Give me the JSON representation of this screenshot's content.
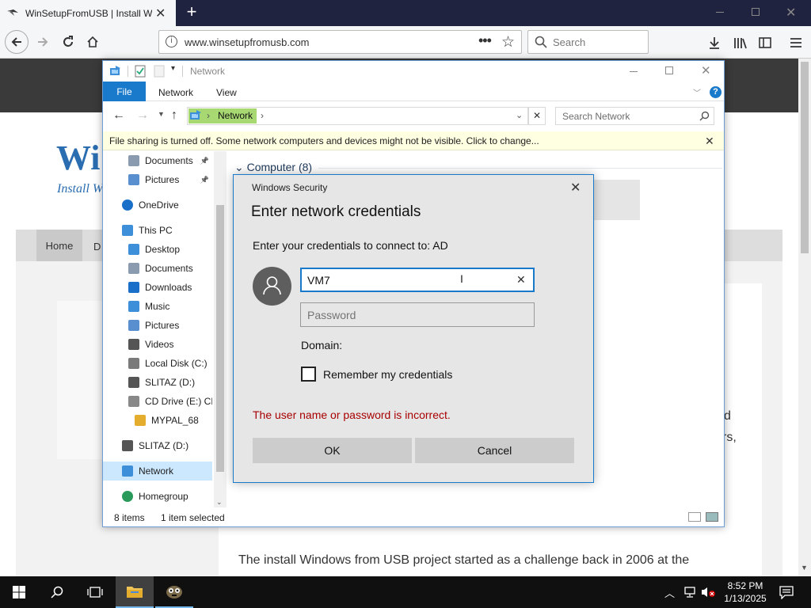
{
  "browser": {
    "tab_title": "WinSetupFromUSB | Install Win",
    "url": "www.winsetupfromusb.com",
    "search_placeholder": "Search"
  },
  "webpage": {
    "site_title": "Wi",
    "site_tagline": "Install W",
    "nav_home": "Home",
    "nav_next": "D",
    "side_text_1": "d",
    "side_text_2": "rs,",
    "paragraph": "The install Windows from USB project started as a challenge back in 2006 at the"
  },
  "explorer": {
    "title": "Network",
    "ribbon_tabs": [
      "File",
      "Network",
      "View"
    ],
    "address_crumb": "Network",
    "search_placeholder": "Search Network",
    "infobar": "File sharing is turned off. Some network computers and devices might not be visible. Click to change...",
    "group_header": "Computer (8)",
    "nav_items": [
      {
        "label": "Documents",
        "icon": "documents-icon",
        "pinned": true
      },
      {
        "label": "Pictures",
        "icon": "pictures-icon",
        "pinned": true
      },
      {
        "label": "OneDrive",
        "icon": "onedrive-icon"
      },
      {
        "label": "This PC",
        "icon": "this-pc-icon"
      },
      {
        "label": "Desktop",
        "icon": "desktop-icon"
      },
      {
        "label": "Documents",
        "icon": "documents-icon"
      },
      {
        "label": "Downloads",
        "icon": "downloads-icon"
      },
      {
        "label": "Music",
        "icon": "music-icon"
      },
      {
        "label": "Pictures",
        "icon": "pictures-icon"
      },
      {
        "label": "Videos",
        "icon": "videos-icon"
      },
      {
        "label": "Local Disk (C:)",
        "icon": "local-disk-icon"
      },
      {
        "label": "SLITAZ (D:)",
        "icon": "drive-icon"
      },
      {
        "label": "CD Drive (E:) CD",
        "icon": "cd-drive-icon"
      },
      {
        "label": "MYPAL_68",
        "icon": "folder-icon"
      },
      {
        "label": "SLITAZ (D:)",
        "icon": "drive-icon"
      },
      {
        "label": "Network",
        "icon": "network-icon"
      },
      {
        "label": "Homegroup",
        "icon": "homegroup-icon"
      }
    ],
    "status_items": "8 items",
    "status_selected": "1 item selected"
  },
  "dialog": {
    "window_title": "Windows Security",
    "heading": "Enter network credentials",
    "subtitle": "Enter your credentials to connect to: AD",
    "username_value": "VM7",
    "password_placeholder": "Password",
    "domain_label": "Domain:",
    "remember_label": "Remember my credentials",
    "error": "The user name or password is incorrect.",
    "ok": "OK",
    "cancel": "Cancel",
    "error_color": "#a80000"
  },
  "taskbar": {
    "time": "8:52 PM",
    "date": "1/13/2025"
  }
}
